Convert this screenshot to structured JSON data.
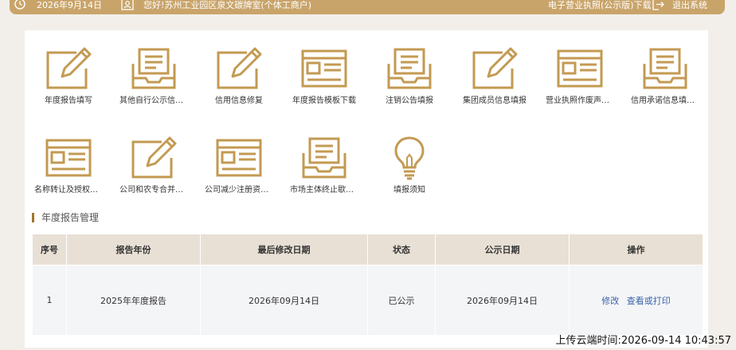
{
  "header": {
    "date": "2026年9月14日",
    "user": "您好!苏州工业园区泉文碳牌室(个体工商户)",
    "license_link": "电子营业执照(公示版)下载",
    "logout": "退出系统",
    "bg_color": "#c9a46a"
  },
  "tiles": [
    {
      "label": "年度报告填写",
      "icon": "edit-icon"
    },
    {
      "label": "其他自行公示信息...",
      "icon": "inbox-icon"
    },
    {
      "label": "信用信息修复",
      "icon": "edit-icon"
    },
    {
      "label": "年度报告模板下载",
      "icon": "form-icon"
    },
    {
      "label": "注销公告填报",
      "icon": "inbox-icon"
    },
    {
      "label": "集团成员信息填报",
      "icon": "edit-icon"
    },
    {
      "label": "营业执照作废声明...",
      "icon": "form-icon"
    },
    {
      "label": "信用承诺信息填报...",
      "icon": "inbox-icon"
    },
    {
      "label": "名称转让及授权信...",
      "icon": "form-icon"
    },
    {
      "label": "公司和农专合并、...",
      "icon": "edit-icon"
    },
    {
      "label": "公司减少注册资本...",
      "icon": "form-icon"
    },
    {
      "label": "市场主体终止歇业...",
      "icon": "inbox-icon"
    },
    {
      "label": "填报须知",
      "icon": "lightbulb-icon"
    }
  ],
  "section": {
    "title": "年度报告管理"
  },
  "table": {
    "headers": [
      "序号",
      "报告年份",
      "最后修改日期",
      "状态",
      "公示日期",
      "操作"
    ],
    "rows": [
      {
        "index": "1",
        "year": "2025年年度报告",
        "modified": "2026年09月14日",
        "status": "已公示",
        "publish": "2026年09月14日",
        "op_edit": "修改",
        "op_view": "查看或打印"
      }
    ]
  },
  "footer": {
    "upload_time": "上传云端时间:2026-09-14 10:43:57"
  },
  "colors": {
    "accent": "#c9a46a",
    "icon": "#c39a52",
    "link": "#3b63a8"
  }
}
